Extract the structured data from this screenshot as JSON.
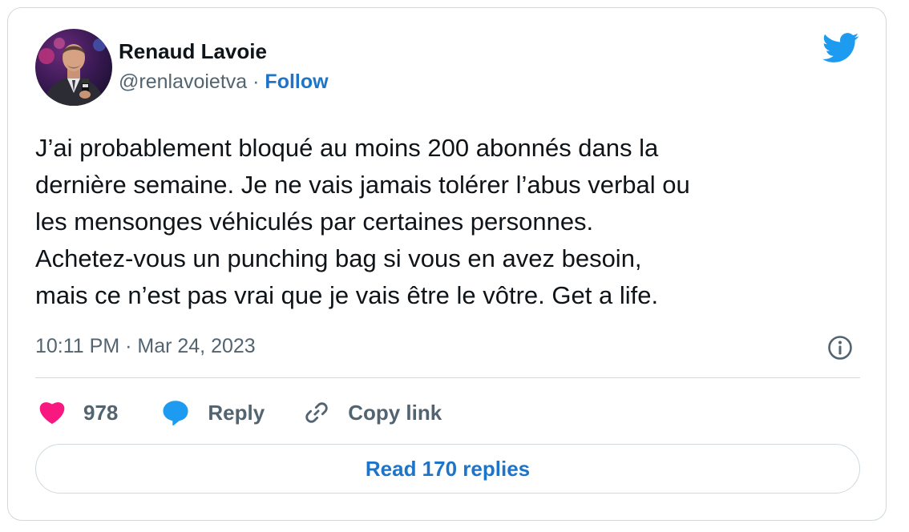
{
  "author": {
    "name": "Renaud Lavoie",
    "handle": "@renlavoietva",
    "separator": "·",
    "follow_label": "Follow"
  },
  "tweet": {
    "lines": [
      "J’ai probablement bloqué au moins 200 abonnés dans la",
      "dernière semaine. Je ne vais jamais tolérer l’abus verbal ou",
      "les mensonges véhiculés par certaines personnes.",
      "Achetez-vous un punching bag si vous en avez besoin,",
      "mais ce n’est pas vrai que je vais être le vôtre. Get a life."
    ],
    "timestamp": "10:11 PM · Mar 24, 2023"
  },
  "actions": {
    "like_count": "978",
    "reply_label": "Reply",
    "copy_link_label": "Copy link"
  },
  "read_replies_label": "Read 170 replies",
  "icons": {
    "brand": "twitter-bird-icon",
    "like": "heart-icon",
    "reply": "speech-bubble-icon",
    "copy": "link-icon",
    "info": "info-icon"
  },
  "colors": {
    "twitter_blue": "#1d9bf0",
    "link_blue": "#1d74c9",
    "heart_pink": "#f91880",
    "secondary_text": "#536471",
    "border": "#cfd9de"
  }
}
